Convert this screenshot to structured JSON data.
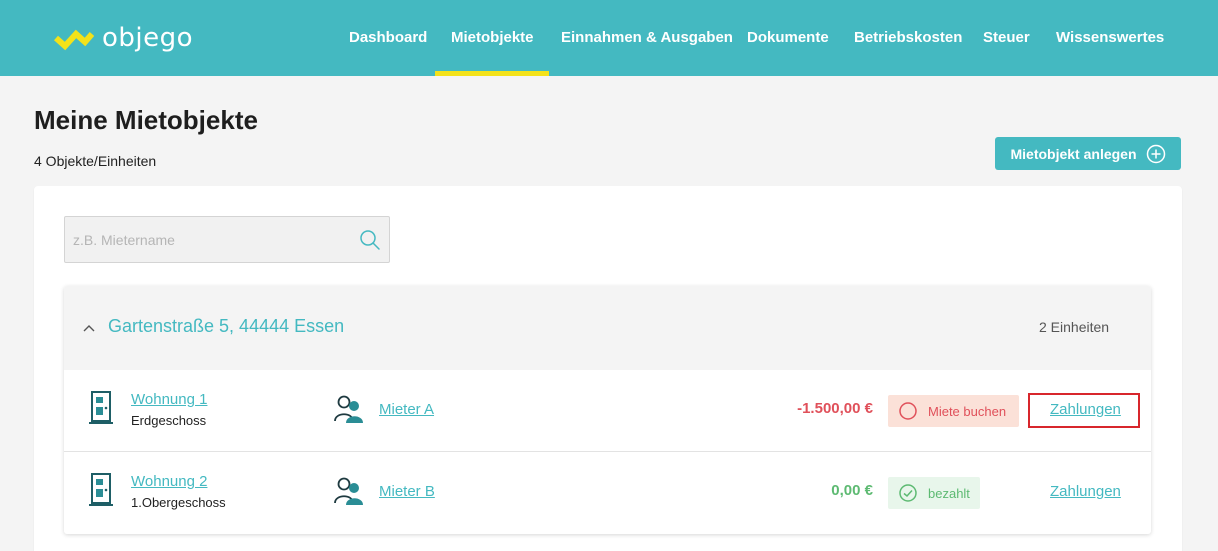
{
  "brand": {
    "name": "objego",
    "accent": "#44b9c1",
    "highlight": "#f3e21a"
  },
  "nav": {
    "items": [
      {
        "label": "Dashboard"
      },
      {
        "label": "Mietobjekte",
        "active": true
      },
      {
        "label": "Einnahmen & Ausgaben"
      },
      {
        "label": "Dokumente"
      },
      {
        "label": "Betriebskosten"
      },
      {
        "label": "Steuer"
      },
      {
        "label": "Wissenswertes"
      }
    ]
  },
  "page": {
    "title": "Meine Mietobjekte",
    "subtitle": "4 Objekte/Einheiten",
    "add_button": "Mietobjekt anlegen"
  },
  "search": {
    "placeholder": "z.B. Mietername",
    "icon": "search-icon"
  },
  "property": {
    "address": "Gartenstraße 5, 44444 Essen",
    "units_count": "2 Einheiten",
    "units": [
      {
        "name": "Wohnung 1",
        "floor": "Erdgeschoss",
        "tenant": "Mieter A",
        "amount": "-1.500,00 €",
        "status_label": "Miete buchen",
        "status_type": "due",
        "payments_link": "Zahlungen"
      },
      {
        "name": "Wohnung 2",
        "floor": "1.Obergeschoss",
        "tenant": "Mieter B",
        "amount": "0,00 €",
        "status_label": "bezahlt",
        "status_type": "paid",
        "payments_link": "Zahlungen"
      }
    ]
  },
  "colors": {
    "negative": "#e0505a",
    "positive": "#5dba72",
    "highlight_box": "#d8262c"
  }
}
